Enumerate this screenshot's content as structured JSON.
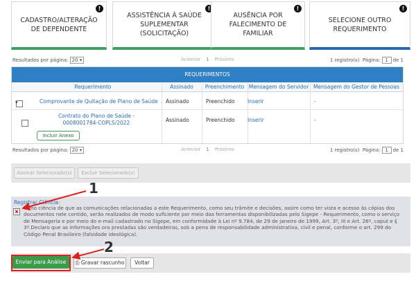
{
  "cards": [
    {
      "label": "CADASTRO/ALTERAÇÃO DE DEPENDENTE",
      "badge": "!"
    },
    {
      "label": "ASSISTÊNCIA À SAÚDE SUPLEMENTAR (SOLICITAÇÃO)",
      "badge": "!"
    },
    {
      "label": "AUSÊNCIA POR FALECIMENTO DE FAMILIAR",
      "badge": "!"
    },
    {
      "label": "SELECIONE OUTRO REQUERIMENTO",
      "badge": "!"
    }
  ],
  "pager": {
    "results_label": "Resultados por página:",
    "per_page": "20",
    "prev": "Anterior",
    "page_num": "1",
    "next": "Próximo",
    "records": "1 registro(s)",
    "page_label": "Página:",
    "page_value": "1",
    "of": "de 1"
  },
  "table": {
    "title": "REQUERIMENTOS",
    "headers": [
      "Requerimento",
      "Assinado",
      "Preenchimento",
      "Mensagem do Servidor",
      "Mensagem do Gestor de Pessoas"
    ],
    "rows": [
      {
        "req": "Comprovante de Quitação de Plano de Saúde",
        "assinado": "Assinado",
        "preench": "Preenchido",
        "msg_serv": "Inserir",
        "msg_gestor": "-"
      },
      {
        "req": "Contrato do Plano de Saúde - 0008001784-COPLS/2022",
        "assinado": "Assinado",
        "preench": "Preenchido",
        "msg_serv": "Inserir",
        "msg_gestor": "-",
        "extra_button": "Incluir Anexo"
      }
    ]
  },
  "actions": {
    "sign_selected": "Assinar Selecionado(s)",
    "delete_selected": "Excluir Selecionado(s)"
  },
  "ciencia": {
    "title": "Registrar Ciência:",
    "text": "Tomo ciência de que as comunicações relacionadas a este Requerimento, como seu trâmite e decisões, assim como ter vista e acesso às cópias dos documentos nele contido, serão realizados de modo suficiente por meio das ferramentas disponibilizadas pelo Sigepe - Requerimento, como o serviço de Mensageria e por meio do e-mail cadastrado no Sigepe, em conformidade à Lei nº 9.784, de 29 de janeiro de 1999, Art. 3º, III e Art. 26º, caput e § 3º.Declaro que as informações ora prestadas são verdadeiras, sob a pena de responsabilidade administrativa, civil e penal, conforme o art. 299 do Código Penal Brasileiro (falsidade ideológica).",
    "checkbox_mark": "x"
  },
  "footer": {
    "submit": "Enviar para Análise",
    "draft": "Gravar rascunho",
    "back": "Voltar"
  },
  "annotations": {
    "one": "1",
    "two": "2"
  },
  "colors": {
    "header_blue": "#2f7fc4",
    "green": "#3a9b49",
    "annotation_red": "#e02020"
  }
}
